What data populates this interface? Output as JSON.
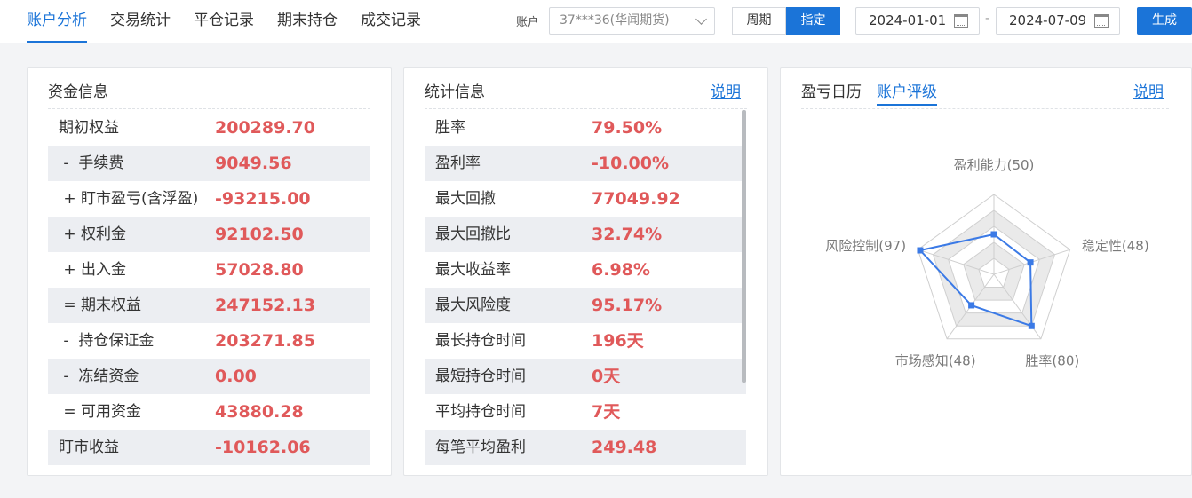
{
  "nav": {
    "tabs": [
      "账户分析",
      "交易统计",
      "平仓记录",
      "期末持仓",
      "成交记录"
    ],
    "active_index": 0
  },
  "filters": {
    "account_label": "账户",
    "account_value": "37***36(华闻期货)",
    "mode_week": "周期",
    "mode_custom": "指定",
    "start_date": "2024-01-01",
    "date_separator": "-",
    "end_date": "2024-07-09",
    "generate": "生成"
  },
  "funds": {
    "title": "资金信息",
    "rows": [
      {
        "label": "期初权益",
        "value": "200289.70"
      },
      {
        "label": " -  手续费",
        "value": "9049.56"
      },
      {
        "label": " + 盯市盈亏(含浮盈)",
        "value": "-93215.00"
      },
      {
        "label": " + 权利金",
        "value": "92102.50"
      },
      {
        "label": " + 出入金",
        "value": "57028.80"
      },
      {
        "label": " = 期末权益",
        "value": "247152.13"
      },
      {
        "label": " -  持仓保证金",
        "value": "203271.85"
      },
      {
        "label": " -  冻结资金",
        "value": "0.00"
      },
      {
        "label": " = 可用资金",
        "value": "43880.28"
      },
      {
        "label": "盯市收益",
        "value": "-10162.06"
      }
    ]
  },
  "stats": {
    "title": "统计信息",
    "help": "说明",
    "rows": [
      {
        "label": "胜率",
        "value": "79.50%"
      },
      {
        "label": "盈利率",
        "value": "-10.00%"
      },
      {
        "label": "最大回撤",
        "value": "77049.92"
      },
      {
        "label": "最大回撤比",
        "value": "32.74%"
      },
      {
        "label": "最大收益率",
        "value": "6.98%"
      },
      {
        "label": "最大风险度",
        "value": "95.17%"
      },
      {
        "label": "最长持仓时间",
        "value": "196天"
      },
      {
        "label": "最短持仓时间",
        "value": "0天"
      },
      {
        "label": "平均持仓时间",
        "value": "7天"
      },
      {
        "label": "每笔平均盈利",
        "value": "249.48"
      }
    ]
  },
  "rating": {
    "tabs": [
      "盈亏日历",
      "账户评级"
    ],
    "active_index": 1,
    "help": "说明",
    "axes": [
      {
        "label": "盈利能力(50)",
        "score": 50
      },
      {
        "label": "稳定性(48)",
        "score": 48
      },
      {
        "label": "胜率(80)",
        "score": 80
      },
      {
        "label": "市场感知(48)",
        "score": 48
      },
      {
        "label": "风险控制(97)",
        "score": 97
      }
    ],
    "max_score": 100,
    "line_color": "#3b7ae6"
  }
}
